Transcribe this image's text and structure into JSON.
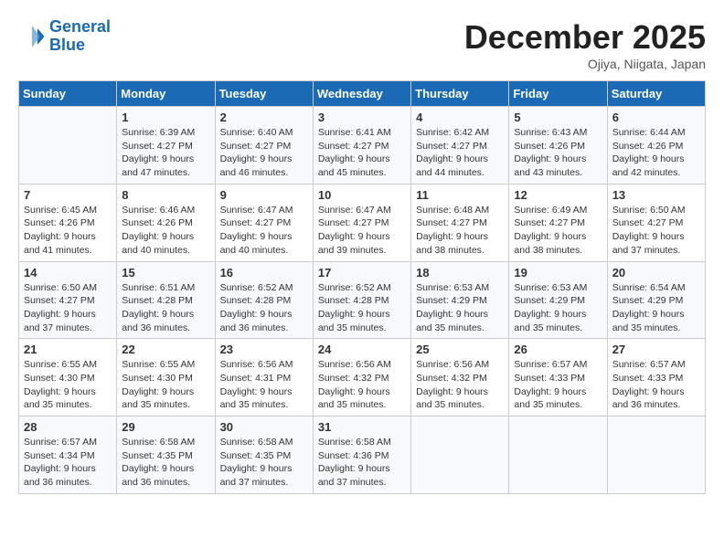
{
  "header": {
    "logo_line1": "General",
    "logo_line2": "Blue",
    "month_title": "December 2025",
    "location": "Ojiya, Niigata, Japan"
  },
  "columns": [
    "Sunday",
    "Monday",
    "Tuesday",
    "Wednesday",
    "Thursday",
    "Friday",
    "Saturday"
  ],
  "weeks": [
    [
      {
        "day": "",
        "sunrise": "",
        "sunset": "",
        "daylight": ""
      },
      {
        "day": "1",
        "sunrise": "Sunrise: 6:39 AM",
        "sunset": "Sunset: 4:27 PM",
        "daylight": "Daylight: 9 hours and 47 minutes."
      },
      {
        "day": "2",
        "sunrise": "Sunrise: 6:40 AM",
        "sunset": "Sunset: 4:27 PM",
        "daylight": "Daylight: 9 hours and 46 minutes."
      },
      {
        "day": "3",
        "sunrise": "Sunrise: 6:41 AM",
        "sunset": "Sunset: 4:27 PM",
        "daylight": "Daylight: 9 hours and 45 minutes."
      },
      {
        "day": "4",
        "sunrise": "Sunrise: 6:42 AM",
        "sunset": "Sunset: 4:27 PM",
        "daylight": "Daylight: 9 hours and 44 minutes."
      },
      {
        "day": "5",
        "sunrise": "Sunrise: 6:43 AM",
        "sunset": "Sunset: 4:26 PM",
        "daylight": "Daylight: 9 hours and 43 minutes."
      },
      {
        "day": "6",
        "sunrise": "Sunrise: 6:44 AM",
        "sunset": "Sunset: 4:26 PM",
        "daylight": "Daylight: 9 hours and 42 minutes."
      }
    ],
    [
      {
        "day": "7",
        "sunrise": "Sunrise: 6:45 AM",
        "sunset": "Sunset: 4:26 PM",
        "daylight": "Daylight: 9 hours and 41 minutes."
      },
      {
        "day": "8",
        "sunrise": "Sunrise: 6:46 AM",
        "sunset": "Sunset: 4:26 PM",
        "daylight": "Daylight: 9 hours and 40 minutes."
      },
      {
        "day": "9",
        "sunrise": "Sunrise: 6:47 AM",
        "sunset": "Sunset: 4:27 PM",
        "daylight": "Daylight: 9 hours and 40 minutes."
      },
      {
        "day": "10",
        "sunrise": "Sunrise: 6:47 AM",
        "sunset": "Sunset: 4:27 PM",
        "daylight": "Daylight: 9 hours and 39 minutes."
      },
      {
        "day": "11",
        "sunrise": "Sunrise: 6:48 AM",
        "sunset": "Sunset: 4:27 PM",
        "daylight": "Daylight: 9 hours and 38 minutes."
      },
      {
        "day": "12",
        "sunrise": "Sunrise: 6:49 AM",
        "sunset": "Sunset: 4:27 PM",
        "daylight": "Daylight: 9 hours and 38 minutes."
      },
      {
        "day": "13",
        "sunrise": "Sunrise: 6:50 AM",
        "sunset": "Sunset: 4:27 PM",
        "daylight": "Daylight: 9 hours and 37 minutes."
      }
    ],
    [
      {
        "day": "14",
        "sunrise": "Sunrise: 6:50 AM",
        "sunset": "Sunset: 4:27 PM",
        "daylight": "Daylight: 9 hours and 37 minutes."
      },
      {
        "day": "15",
        "sunrise": "Sunrise: 6:51 AM",
        "sunset": "Sunset: 4:28 PM",
        "daylight": "Daylight: 9 hours and 36 minutes."
      },
      {
        "day": "16",
        "sunrise": "Sunrise: 6:52 AM",
        "sunset": "Sunset: 4:28 PM",
        "daylight": "Daylight: 9 hours and 36 minutes."
      },
      {
        "day": "17",
        "sunrise": "Sunrise: 6:52 AM",
        "sunset": "Sunset: 4:28 PM",
        "daylight": "Daylight: 9 hours and 35 minutes."
      },
      {
        "day": "18",
        "sunrise": "Sunrise: 6:53 AM",
        "sunset": "Sunset: 4:29 PM",
        "daylight": "Daylight: 9 hours and 35 minutes."
      },
      {
        "day": "19",
        "sunrise": "Sunrise: 6:53 AM",
        "sunset": "Sunset: 4:29 PM",
        "daylight": "Daylight: 9 hours and 35 minutes."
      },
      {
        "day": "20",
        "sunrise": "Sunrise: 6:54 AM",
        "sunset": "Sunset: 4:29 PM",
        "daylight": "Daylight: 9 hours and 35 minutes."
      }
    ],
    [
      {
        "day": "21",
        "sunrise": "Sunrise: 6:55 AM",
        "sunset": "Sunset: 4:30 PM",
        "daylight": "Daylight: 9 hours and 35 minutes."
      },
      {
        "day": "22",
        "sunrise": "Sunrise: 6:55 AM",
        "sunset": "Sunset: 4:30 PM",
        "daylight": "Daylight: 9 hours and 35 minutes."
      },
      {
        "day": "23",
        "sunrise": "Sunrise: 6:56 AM",
        "sunset": "Sunset: 4:31 PM",
        "daylight": "Daylight: 9 hours and 35 minutes."
      },
      {
        "day": "24",
        "sunrise": "Sunrise: 6:56 AM",
        "sunset": "Sunset: 4:32 PM",
        "daylight": "Daylight: 9 hours and 35 minutes."
      },
      {
        "day": "25",
        "sunrise": "Sunrise: 6:56 AM",
        "sunset": "Sunset: 4:32 PM",
        "daylight": "Daylight: 9 hours and 35 minutes."
      },
      {
        "day": "26",
        "sunrise": "Sunrise: 6:57 AM",
        "sunset": "Sunset: 4:33 PM",
        "daylight": "Daylight: 9 hours and 35 minutes."
      },
      {
        "day": "27",
        "sunrise": "Sunrise: 6:57 AM",
        "sunset": "Sunset: 4:33 PM",
        "daylight": "Daylight: 9 hours and 36 minutes."
      }
    ],
    [
      {
        "day": "28",
        "sunrise": "Sunrise: 6:57 AM",
        "sunset": "Sunset: 4:34 PM",
        "daylight": "Daylight: 9 hours and 36 minutes."
      },
      {
        "day": "29",
        "sunrise": "Sunrise: 6:58 AM",
        "sunset": "Sunset: 4:35 PM",
        "daylight": "Daylight: 9 hours and 36 minutes."
      },
      {
        "day": "30",
        "sunrise": "Sunrise: 6:58 AM",
        "sunset": "Sunset: 4:35 PM",
        "daylight": "Daylight: 9 hours and 37 minutes."
      },
      {
        "day": "31",
        "sunrise": "Sunrise: 6:58 AM",
        "sunset": "Sunset: 4:36 PM",
        "daylight": "Daylight: 9 hours and 37 minutes."
      },
      {
        "day": "",
        "sunrise": "",
        "sunset": "",
        "daylight": ""
      },
      {
        "day": "",
        "sunrise": "",
        "sunset": "",
        "daylight": ""
      },
      {
        "day": "",
        "sunrise": "",
        "sunset": "",
        "daylight": ""
      }
    ]
  ]
}
